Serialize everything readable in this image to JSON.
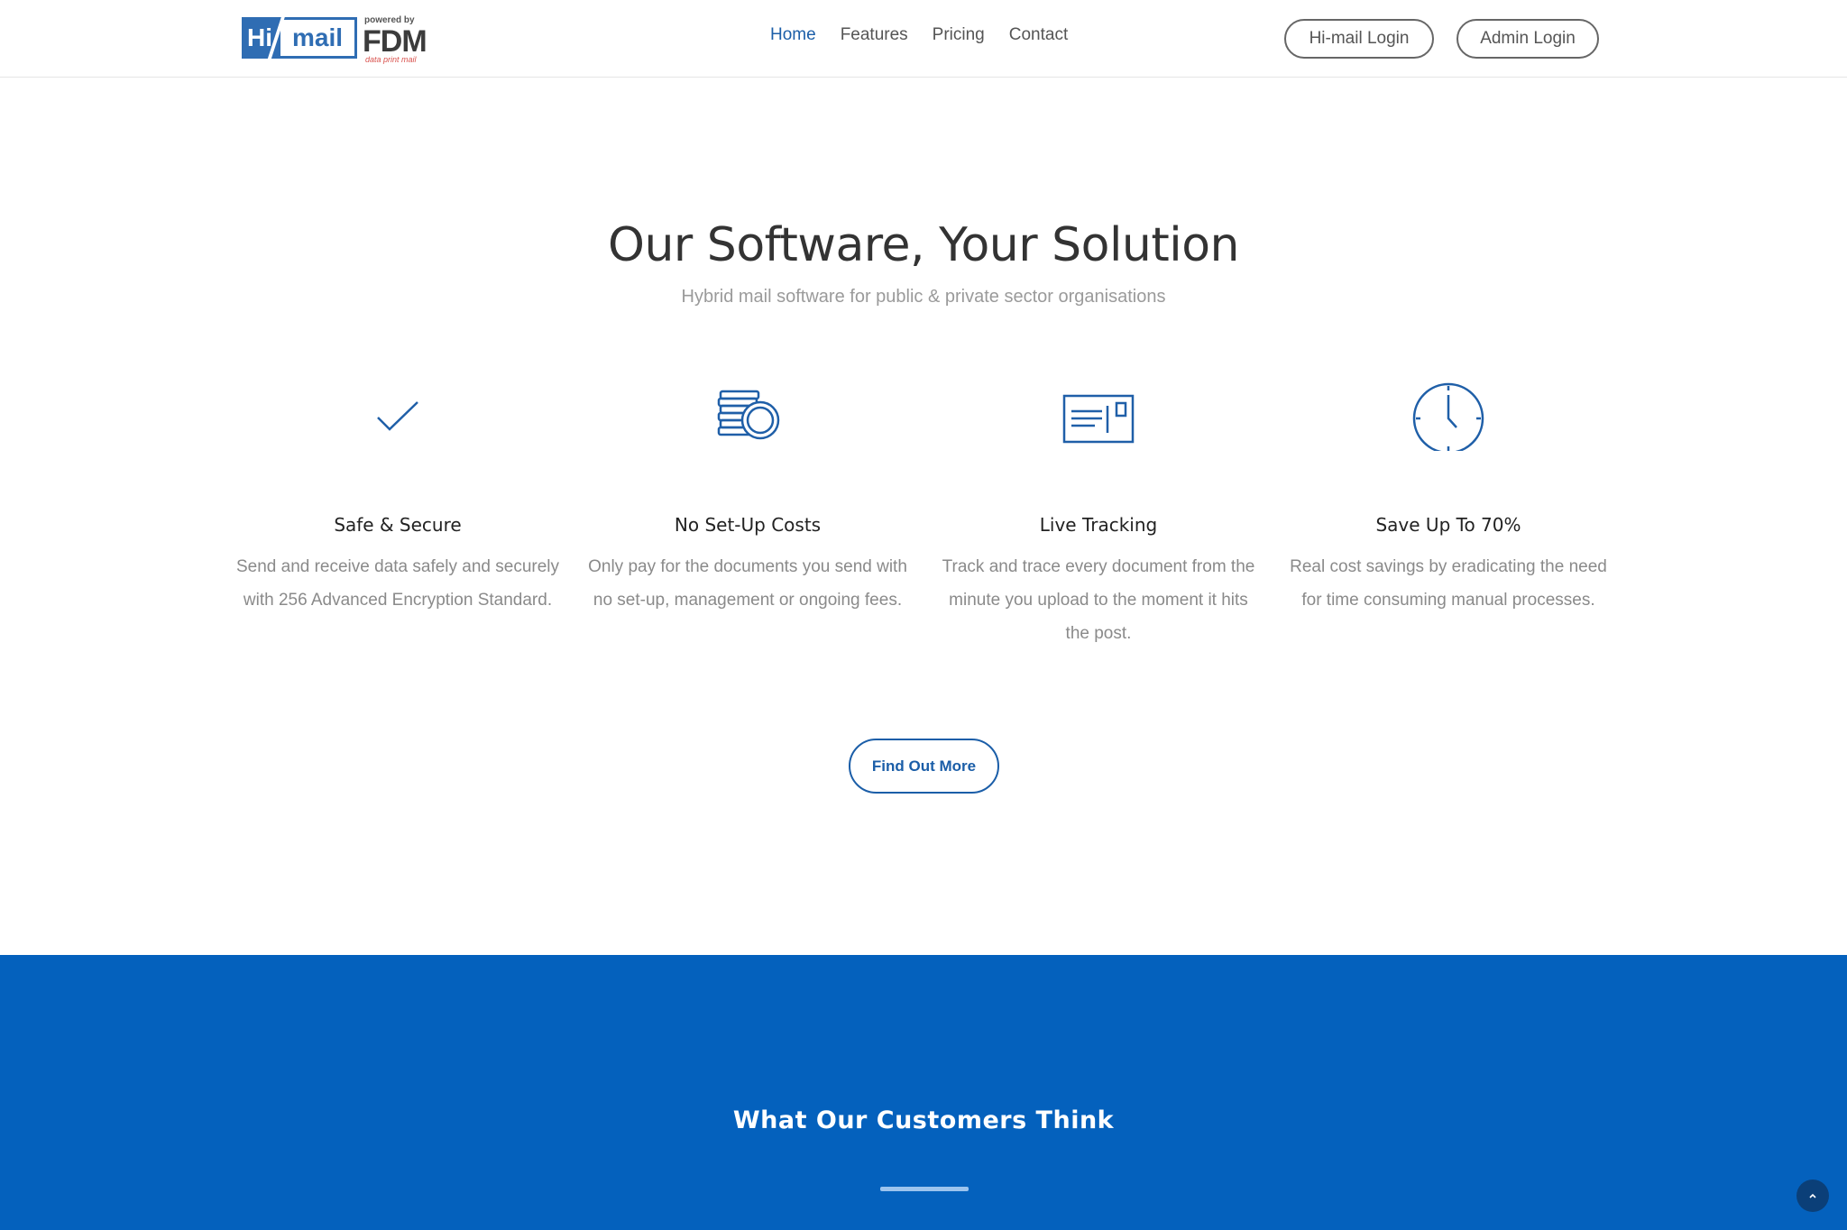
{
  "header": {
    "logo": {
      "hi": "Hi",
      "mail": "mail",
      "powered_by": "powered by",
      "fdm": "FDM",
      "tagline": "data print mail"
    },
    "nav": [
      {
        "label": "Home",
        "active": true
      },
      {
        "label": "Features",
        "active": false
      },
      {
        "label": "Pricing",
        "active": false
      },
      {
        "label": "Contact",
        "active": false
      }
    ],
    "himail_login": "Hi-mail Login",
    "admin_login": "Admin Login"
  },
  "hero": {
    "title": "Our Software, Your Solution",
    "subtitle": "Hybrid mail software for public & private sector organisations"
  },
  "features": [
    {
      "icon": "checkmark-icon",
      "title": "Safe & Secure",
      "text": "Send and receive data safely and securely with 256 Advanced Encryption Standard."
    },
    {
      "icon": "coins-icon",
      "title": "No Set-Up Costs",
      "text": "Only pay for the documents you send with no set-up, management or ongoing fees."
    },
    {
      "icon": "postcard-icon",
      "title": "Live Tracking",
      "text": "Track and trace every document from the minute you upload to the moment it hits the post."
    },
    {
      "icon": "clock-icon",
      "title": "Save Up To 70%",
      "text": "Real cost savings by eradicating the need for time consuming manual processes."
    }
  ],
  "cta": {
    "label": "Find Out More"
  },
  "testimonials": {
    "title": "What Our Customers Think"
  },
  "colors": {
    "brand_blue": "#1b5ea8",
    "band_blue": "#0461bd",
    "icon_blue": "#1f5fa8"
  }
}
